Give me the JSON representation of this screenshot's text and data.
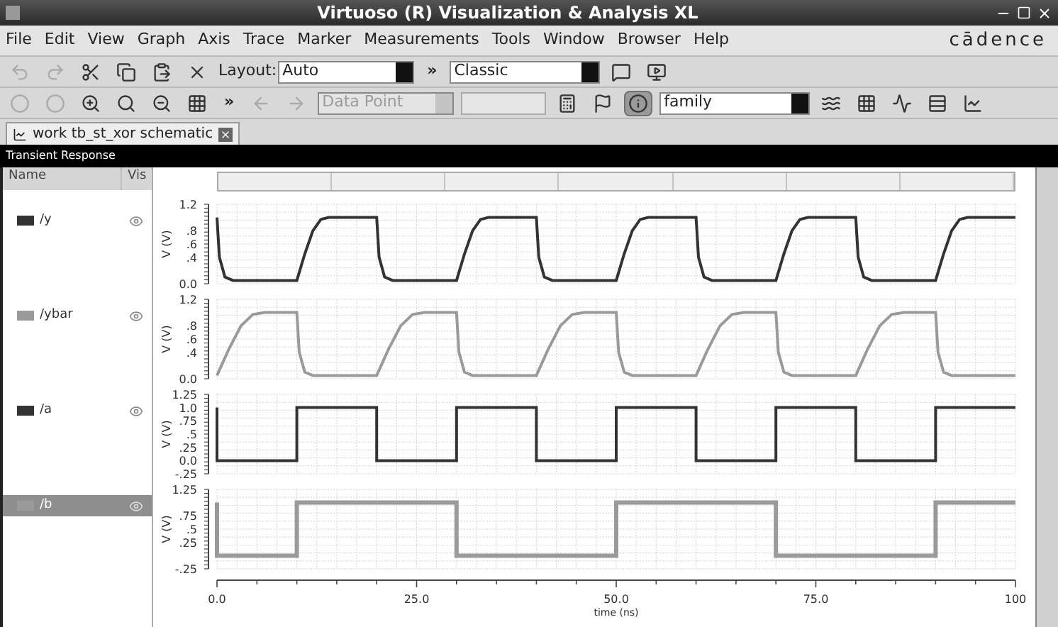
{
  "window": {
    "title": "Virtuoso (R) Visualization & Analysis XL"
  },
  "menu": [
    "File",
    "Edit",
    "View",
    "Graph",
    "Axis",
    "Trace",
    "Marker",
    "Measurements",
    "Tools",
    "Window",
    "Browser",
    "Help"
  ],
  "logo": "cādence",
  "toolbar_1": [
    {
      "kind": "icon",
      "disabled": true
    },
    {
      "kind": "icon",
      "disabled": true
    },
    {
      "kind": "icon",
      "disabled": false
    },
    {
      "kind": "icon",
      "disabled": false
    },
    {
      "kind": "icon",
      "disabled": false
    },
    {
      "kind": "icon",
      "disabled": false
    },
    {
      "kind": "dropdown",
      "label": "Layout:",
      "value": "Auto",
      "disabled": false
    },
    {
      "kind": "overflow",
      "text": "»"
    },
    {
      "kind": "dropdown",
      "value": "Classic",
      "disabled": false
    },
    {
      "kind": "icon",
      "disabled": false
    },
    {
      "kind": "icon",
      "disabled": false
    }
  ],
  "toolbar_2": [
    {
      "kind": "icon",
      "disabled": true
    },
    {
      "kind": "icon",
      "disabled": true
    },
    {
      "kind": "icon",
      "disabled": false
    },
    {
      "kind": "icon",
      "disabled": false
    },
    {
      "kind": "icon",
      "disabled": false
    },
    {
      "kind": "icon",
      "disabled": false
    },
    {
      "kind": "overflow",
      "text": "»"
    },
    {
      "kind": "icon",
      "disabled": true
    },
    {
      "kind": "icon",
      "disabled": true
    },
    {
      "kind": "dropdown",
      "value": "Data Point",
      "disabled": true
    },
    {
      "kind": "field",
      "disabled": true
    },
    {
      "kind": "icon",
      "disabled": false
    },
    {
      "kind": "icon",
      "disabled": false
    },
    {
      "kind": "toggle",
      "pressed": true
    },
    {
      "kind": "dropdown",
      "value": "family",
      "disabled": false
    },
    {
      "kind": "icon",
      "disabled": false
    },
    {
      "kind": "icon",
      "disabled": false
    },
    {
      "kind": "icon",
      "disabled": false
    },
    {
      "kind": "icon",
      "disabled": false
    },
    {
      "kind": "icon",
      "disabled": false
    }
  ],
  "tabs": [
    {
      "label": "work tb_st_xor schematic",
      "selected": true
    }
  ],
  "panel": {
    "title": "Transient Response"
  },
  "signal_list": {
    "columns": [
      "Name",
      "Vis"
    ],
    "rows": [
      {
        "name": "/y",
        "color": "#333333",
        "selected": false
      },
      {
        "name": "/ybar",
        "color": "#9a9a9a",
        "selected": false
      },
      {
        "name": "/a",
        "color": "#333333",
        "selected": false
      },
      {
        "name": "/b",
        "color": "#9a9a9a",
        "selected": true
      }
    ]
  },
  "plots": [
    {
      "chart_data": {
        "type": "line",
        "ylabel": "V (V)",
        "xlim": [
          0,
          100
        ],
        "ylim": [
          0,
          1.2
        ],
        "yticks": [
          {
            "value": 1.2,
            "label": "1.2"
          },
          {
            "value": 0.8,
            "label": ".8"
          },
          {
            "value": 0.6,
            "label": ".6"
          },
          {
            "value": 0.4,
            "label": ".4"
          },
          {
            "value": 0,
            "label": "0.0"
          }
        ],
        "x": [
          0,
          0.3,
          1,
          2,
          10,
          11,
          12,
          13,
          14,
          20,
          20.3,
          21,
          22,
          30,
          31,
          32,
          33,
          34,
          40,
          40.3,
          41,
          42,
          50,
          51,
          52,
          53,
          54,
          60,
          60.3,
          61,
          62,
          70,
          71,
          72,
          73,
          74,
          80,
          80.3,
          81,
          82,
          90,
          91,
          92,
          93,
          94,
          100
        ],
        "grid": true,
        "series": [
          {
            "color": "#333333",
            "values": [
              1,
              0.4,
              0.1,
              0.05,
              0.05,
              0.45,
              0.8,
              0.97,
              1,
              1,
              0.4,
              0.1,
              0.05,
              0.05,
              0.45,
              0.8,
              0.97,
              1,
              1,
              0.4,
              0.1,
              0.05,
              0.05,
              0.45,
              0.8,
              0.97,
              1,
              1,
              0.4,
              0.1,
              0.05,
              0.05,
              0.45,
              0.8,
              0.97,
              1,
              1,
              0.4,
              0.1,
              0.05,
              0.05,
              0.45,
              0.8,
              0.97,
              1,
              1
            ]
          }
        ]
      }
    },
    {
      "chart_data": {
        "type": "line",
        "ylabel": "V (V)",
        "xlim": [
          0,
          100
        ],
        "ylim": [
          0,
          1.2
        ],
        "yticks": [
          {
            "value": 1.2,
            "label": "1.2"
          },
          {
            "value": 0.8,
            "label": ".8"
          },
          {
            "value": 0.6,
            "label": ".6"
          },
          {
            "value": 0.4,
            "label": ".4"
          },
          {
            "value": 0,
            "label": "0.0"
          }
        ],
        "x": [
          0,
          1.5,
          3,
          4.5,
          6,
          10,
          10.3,
          11,
          12,
          20,
          21.5,
          23,
          24.5,
          26,
          30,
          30.3,
          31,
          32,
          40,
          41.5,
          43,
          44.5,
          46,
          50,
          50.3,
          51,
          52,
          60,
          61.5,
          63,
          64.5,
          66,
          70,
          70.3,
          71,
          72,
          80,
          81.5,
          83,
          84.5,
          86,
          90,
          90.3,
          91,
          92,
          100
        ],
        "grid": true,
        "series": [
          {
            "color": "#9a9a9a",
            "values": [
              0.05,
              0.45,
              0.8,
              0.97,
              1,
              1,
              0.4,
              0.1,
              0.05,
              0.05,
              0.45,
              0.8,
              0.97,
              1,
              1,
              0.4,
              0.1,
              0.05,
              0.05,
              0.45,
              0.8,
              0.97,
              1,
              1,
              0.4,
              0.1,
              0.05,
              0.05,
              0.45,
              0.8,
              0.97,
              1,
              1,
              0.4,
              0.1,
              0.05,
              0.05,
              0.45,
              0.8,
              0.97,
              1,
              1,
              0.4,
              0.1,
              0.05,
              0.05
            ]
          }
        ]
      }
    },
    {
      "chart_data": {
        "type": "line",
        "ylabel": "V (V)",
        "xlim": [
          0,
          100
        ],
        "ylim": [
          -0.25,
          1.25
        ],
        "yticks": [
          {
            "value": 1.25,
            "label": "1.25"
          },
          {
            "value": 1,
            "label": "1.0"
          },
          {
            "value": 0.75,
            "label": ".75"
          },
          {
            "value": 0.5,
            "label": ".5"
          },
          {
            "value": 0.25,
            "label": ".25"
          },
          {
            "value": 0,
            "label": "0.0"
          },
          {
            "value": -0.25,
            "label": "-.25"
          }
        ],
        "x": [
          0,
          0,
          10,
          10,
          20,
          20,
          30,
          30,
          40,
          40,
          50,
          50,
          60,
          60,
          70,
          70,
          80,
          80,
          90,
          90,
          100
        ],
        "grid": true,
        "series": [
          {
            "color": "#333333",
            "values": [
              1,
              0,
              0,
              1,
              1,
              0,
              0,
              1,
              1,
              0,
              0,
              1,
              1,
              0,
              0,
              1,
              1,
              0,
              0,
              1,
              1
            ]
          }
        ]
      }
    },
    {
      "chart_data": {
        "type": "line",
        "ylabel": "V (V)",
        "xlabel": "time (ns)",
        "xlim": [
          0,
          100
        ],
        "ylim": [
          -0.25,
          1.25
        ],
        "yticks": [
          {
            "value": 1.25,
            "label": "1.25"
          },
          {
            "value": 0.75,
            "label": ".75"
          },
          {
            "value": 0.5,
            "label": ".5"
          },
          {
            "value": 0.25,
            "label": ".25"
          },
          {
            "value": -0.25,
            "label": "-.25"
          }
        ],
        "xticks": [
          {
            "value": 0,
            "label": "0.0"
          },
          {
            "value": 25,
            "label": "25.0"
          },
          {
            "value": 50,
            "label": "50.0"
          },
          {
            "value": 75,
            "label": "75.0"
          },
          {
            "value": 100,
            "label": "100"
          }
        ],
        "x": [
          0,
          0,
          10,
          10,
          20,
          20,
          30,
          30,
          40,
          40,
          50,
          50,
          60,
          60,
          70,
          70,
          80,
          80,
          90,
          90,
          100
        ],
        "grid": true,
        "series": [
          {
            "color": "#9a9a9a",
            "values": [
              1,
              0,
              0,
              1,
              1,
              1,
              1,
              0,
              0,
              0,
              0,
              1,
              1,
              1,
              1,
              0,
              0,
              0,
              0,
              1,
              1
            ]
          }
        ]
      }
    }
  ]
}
